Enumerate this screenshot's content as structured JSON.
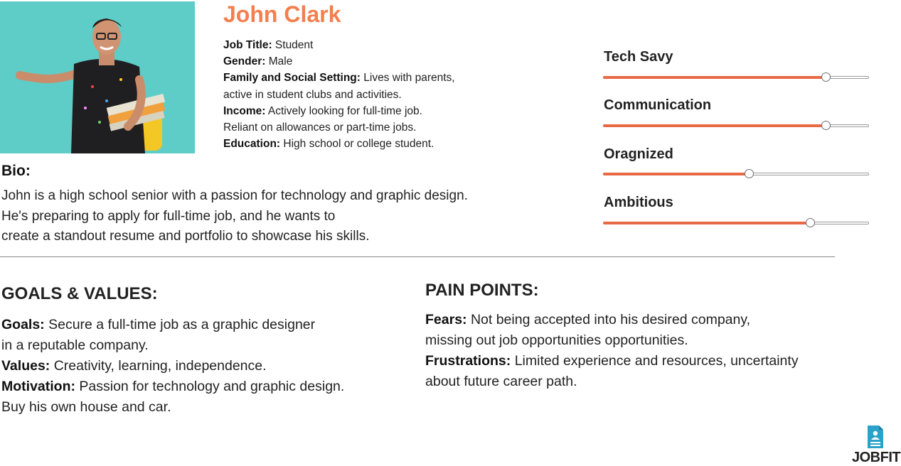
{
  "persona": {
    "name": "John Clark",
    "details": [
      {
        "label": "Job Title:",
        "lines": [
          "Student"
        ]
      },
      {
        "label": "Gender:",
        "lines": [
          "Male"
        ]
      },
      {
        "label": "Family and Social Setting:",
        "lines": [
          "Lives with parents,",
          "active in student clubs and activities."
        ]
      },
      {
        "label": "Income:",
        "lines": [
          "Actively looking for full-time job.",
          "Reliant on allowances or part-time jobs."
        ]
      },
      {
        "label": "Education:",
        "lines": [
          "High school or college student."
        ]
      }
    ]
  },
  "bio": {
    "title": "Bio:",
    "lines": [
      "John is a high school senior with a passion for technology and graphic design.",
      "He's preparing to apply for full-time job, and he wants to",
      "create a standout resume and portfolio to showcase his skills."
    ]
  },
  "traits": [
    {
      "label": "Tech Savy",
      "level": 0.84
    },
    {
      "label": "Communication",
      "level": 0.84
    },
    {
      "label": "Oragnized",
      "level": 0.55
    },
    {
      "label": "Ambitious",
      "level": 0.78
    }
  ],
  "goals": {
    "title": "GOALS & VALUES:",
    "items": [
      {
        "label": "Goals:",
        "lines": [
          "Secure a full-time job as a graphic designer",
          "in a reputable company."
        ]
      },
      {
        "label": "Values:",
        "lines": [
          "Creativity, learning, independence."
        ]
      },
      {
        "label": "Motivation:",
        "lines": [
          "Passion for technology and graphic design.",
          "Buy his own house and car."
        ]
      }
    ]
  },
  "pain_points": {
    "title": "PAIN POINTS:",
    "items": [
      {
        "label": "Fears:",
        "lines": [
          "Not being accepted into his desired company,",
          "missing out job opportunities opportunities."
        ]
      },
      {
        "label": "Frustrations:",
        "lines": [
          "Limited experience and resources, uncertainty",
          "about future career path."
        ]
      }
    ]
  },
  "logo": {
    "text": "JOBFIT",
    "icon": "document-person-icon"
  },
  "colors": {
    "accent": "#f37f4e",
    "slider_fill": "#e86a45",
    "photo_bg": "#5ecdc8",
    "logo_icon": "#29a3c9"
  }
}
